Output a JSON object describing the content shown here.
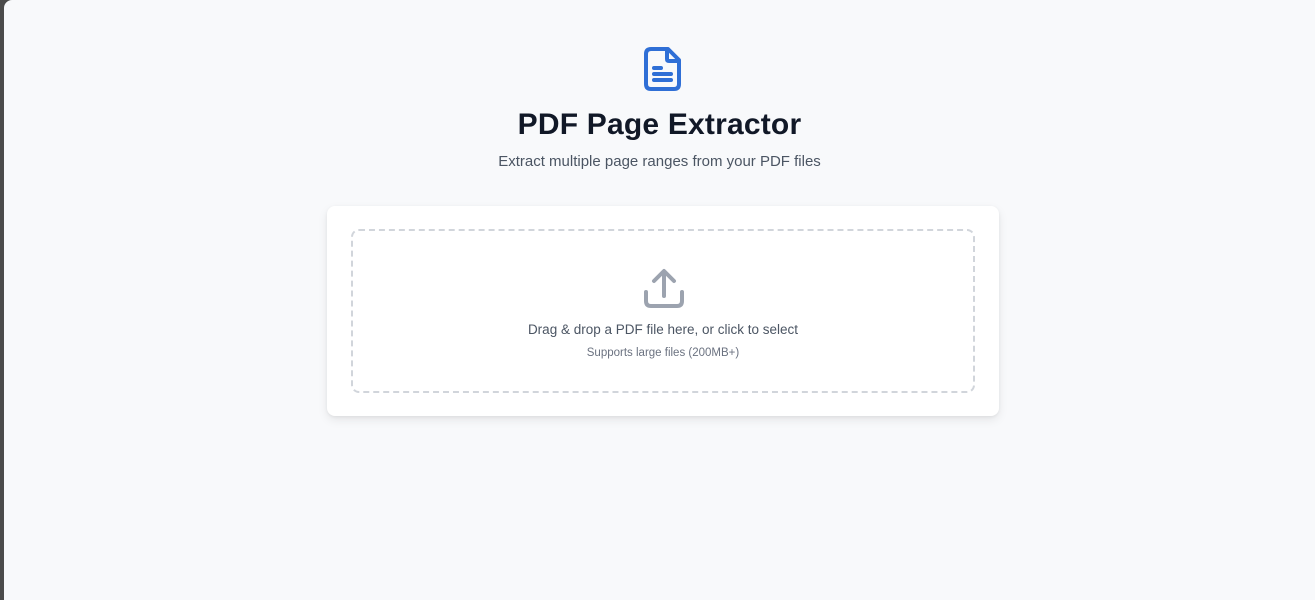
{
  "header": {
    "icon": "document-icon",
    "title": "PDF Page Extractor",
    "subtitle": "Extract multiple page ranges from your PDF files"
  },
  "dropzone": {
    "icon": "upload-icon",
    "label": "Drag & drop a PDF file here, or click to select",
    "hint": "Supports large files (200MB+)"
  },
  "colors": {
    "accent": "#2f6fd6",
    "background": "#f8f9fb",
    "title": "#111827",
    "muted": "#4b5563",
    "icon_gray": "#9ca3af"
  }
}
